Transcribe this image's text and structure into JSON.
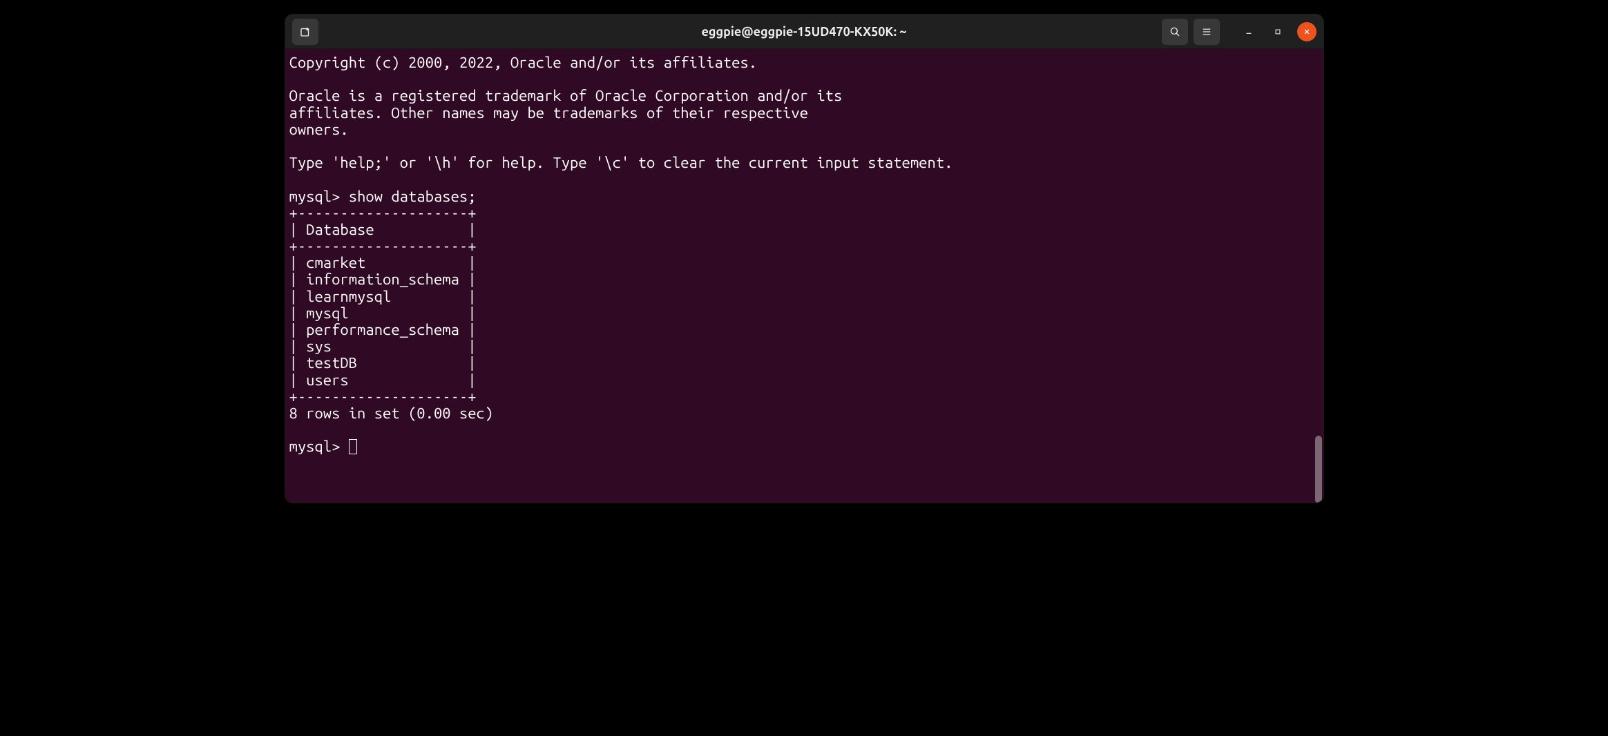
{
  "window": {
    "title": "eggpie@eggpie-15UD470-KX50K: ~"
  },
  "terminal": {
    "copyright": "Copyright (c) 2000, 2022, Oracle and/or its affiliates.",
    "trademark_line1": "Oracle is a registered trademark of Oracle Corporation and/or its",
    "trademark_line2": "affiliates. Other names may be trademarks of their respective",
    "trademark_line3": "owners.",
    "help_line": "Type 'help;' or '\\h' for help. Type '\\c' to clear the current input statement.",
    "prompt1": "mysql> ",
    "command1": "show databases;",
    "table_border": "+--------------------+",
    "table_header": "| Database           |",
    "rows": [
      "| cmarket            |",
      "| information_schema |",
      "| learnmysql         |",
      "| mysql              |",
      "| performance_schema |",
      "| sys                |",
      "| testDB             |",
      "| users              |"
    ],
    "result_summary": "8 rows in set (0.00 sec)",
    "prompt2": "mysql> "
  }
}
